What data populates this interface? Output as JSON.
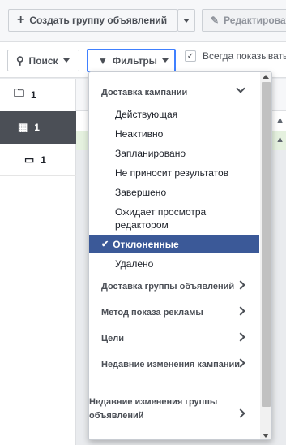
{
  "toolbar": {
    "create_label": "Создать группу объявлений",
    "edit_label": "Редактировать"
  },
  "filterbar": {
    "search_label": "Поиск",
    "filters_label": "Фильтры",
    "always_show_label": "Всегда показывать"
  },
  "tree": {
    "campaign_count": "1",
    "adset_count": "1",
    "ad_count": "1"
  },
  "filters_menu": {
    "section_delivery": "Доставка кампании",
    "delivery_options": [
      "Действующая",
      "Неактивно",
      "Запланировано",
      "Не приносит результатов",
      "Завершено",
      "Ожидает просмотра редактором",
      "Отклоненные",
      "Удалено"
    ],
    "selected_option": "Отклоненные",
    "section_adset_delivery": "Доставка группы объявлений",
    "section_ad_method": "Метод показа рекламы",
    "section_goals": "Цели",
    "section_recent_campaign": "Недавние изменения кампании",
    "section_recent_adset": "Недавние изменения группы объявлений"
  }
}
